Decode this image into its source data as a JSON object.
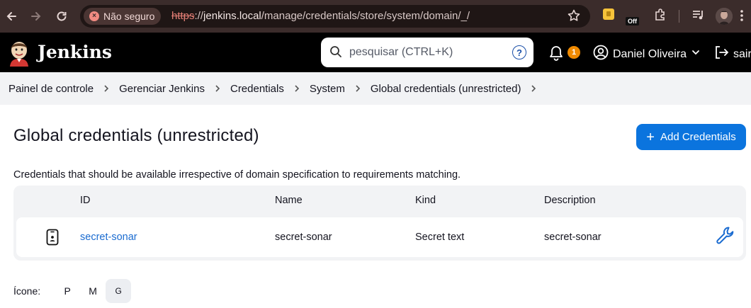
{
  "browser": {
    "security_label": "Não seguro",
    "url_scheme": "https",
    "url_sep": "://",
    "url_host": "jenkins.local",
    "url_path": "/manage/credentials/store/system/domain/_/",
    "extension_badge": "Off",
    "icons": [
      "back-icon",
      "forward-icon",
      "reload-icon",
      "star-icon",
      "extensions-icon",
      "media-icon",
      "profile-avatar"
    ]
  },
  "header": {
    "brand": "Jenkins",
    "search_placeholder": "pesquisar (CTRL+K)",
    "help": "?",
    "notifications_count": "1",
    "user_name": "Daniel Oliveira",
    "logout_label": "sair"
  },
  "breadcrumb": {
    "items": [
      "Painel de controle",
      "Gerenciar Jenkins",
      "Credentials",
      "System",
      "Global credentials (unrestricted)"
    ]
  },
  "main": {
    "title": "Global credentials (unrestricted)",
    "add_button_label": "Add Credentials",
    "description": "Credentials that should be available irrespective of domain specification to requirements matching.",
    "table": {
      "columns": [
        "ID",
        "Name",
        "Kind",
        "Description"
      ],
      "rows": [
        {
          "id": "secret-sonar",
          "name": "secret-sonar",
          "kind": "Secret text",
          "description": "secret-sonar"
        }
      ]
    },
    "icon_size": {
      "label": "Ícone:",
      "options": [
        "P",
        "M",
        "G"
      ],
      "selected": "G"
    }
  },
  "colors": {
    "accent": "#0b74de",
    "header_bg": "#000000",
    "notification": "#f08a00",
    "link": "#1a6bd0"
  }
}
